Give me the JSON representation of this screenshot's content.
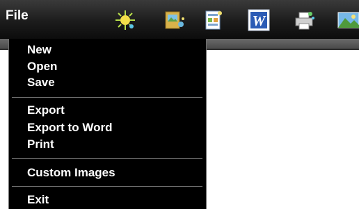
{
  "menubar": {
    "file_label": "File"
  },
  "toolbar": {
    "icons": [
      "brightness-sparkle-icon",
      "folder-picture-icon",
      "document-sparkle-icon",
      "word-document-icon",
      "printer-sparkle-icon",
      "landscape-image-icon"
    ],
    "word_icon_letter": "W"
  },
  "file_menu": {
    "groups": [
      [
        "New",
        "Open",
        "Save"
      ],
      [
        "Export",
        "Export to Word",
        "Print"
      ],
      [
        "Custom Images"
      ],
      [
        "Exit"
      ]
    ]
  },
  "colors": {
    "toolbar_bg": "#1c1c1c",
    "menu_bg": "#000000",
    "menu_text": "#ffffff",
    "separator": "#6e6e6e",
    "word_blue": "#2b5bb5"
  }
}
